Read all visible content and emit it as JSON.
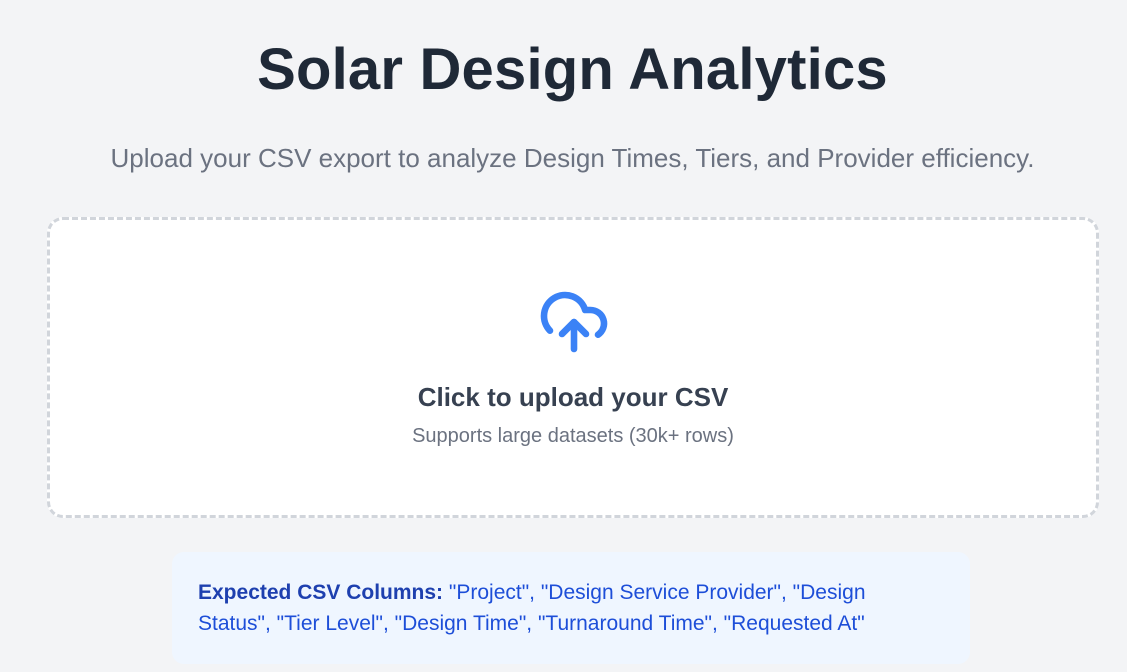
{
  "header": {
    "title": "Solar Design Analytics",
    "subtitle": "Upload your CSV export to analyze Design Times, Tiers, and Provider efficiency."
  },
  "upload": {
    "icon": "cloud-upload-icon",
    "heading": "Click to upload your CSV",
    "subtext": "Supports large datasets (30k+ rows)"
  },
  "info": {
    "label": "Expected CSV Columns:",
    "columns_text": "\"Project\", \"Design Service Provider\", \"Design Status\", \"Tier Level\", \"Design Time\", \"Turnaround Time\", \"Requested At\""
  },
  "colors": {
    "background": "#f3f4f6",
    "title": "#1f2937",
    "accent": "#3b82f6",
    "info_background": "#eff6ff",
    "info_text": "#1d4ed8"
  }
}
